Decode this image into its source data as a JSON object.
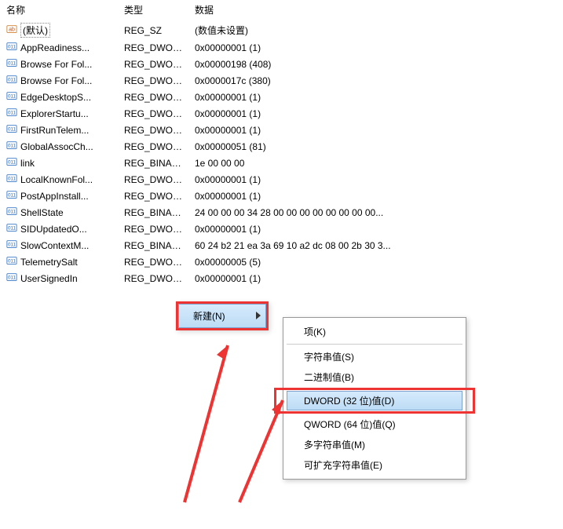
{
  "headers": {
    "name": "名称",
    "type": "类型",
    "data": "数据"
  },
  "rows": [
    {
      "icon": "string",
      "name": "(默认)",
      "type": "REG_SZ",
      "data": "(数值未设置)",
      "focus": true
    },
    {
      "icon": "dword",
      "name": "AppReadiness...",
      "type": "REG_DWORD",
      "data": "0x00000001 (1)"
    },
    {
      "icon": "dword",
      "name": "Browse For Fol...",
      "type": "REG_DWORD",
      "data": "0x00000198 (408)"
    },
    {
      "icon": "dword",
      "name": "Browse For Fol...",
      "type": "REG_DWORD",
      "data": "0x0000017c (380)"
    },
    {
      "icon": "dword",
      "name": "EdgeDesktopS...",
      "type": "REG_DWORD",
      "data": "0x00000001 (1)"
    },
    {
      "icon": "dword",
      "name": "ExplorerStartu...",
      "type": "REG_DWORD",
      "data": "0x00000001 (1)"
    },
    {
      "icon": "dword",
      "name": "FirstRunTelem...",
      "type": "REG_DWORD",
      "data": "0x00000001 (1)"
    },
    {
      "icon": "dword",
      "name": "GlobalAssocCh...",
      "type": "REG_DWORD",
      "data": "0x00000051 (81)"
    },
    {
      "icon": "binary",
      "name": "link",
      "type": "REG_BINARY",
      "data": "1e 00 00 00"
    },
    {
      "icon": "dword",
      "name": "LocalKnownFol...",
      "type": "REG_DWORD",
      "data": "0x00000001 (1)"
    },
    {
      "icon": "dword",
      "name": "PostAppInstall...",
      "type": "REG_DWORD",
      "data": "0x00000001 (1)"
    },
    {
      "icon": "binary",
      "name": "ShellState",
      "type": "REG_BINARY",
      "data": "24 00 00 00 34 28 00 00 00 00 00 00 00 00..."
    },
    {
      "icon": "dword",
      "name": "SIDUpdatedO...",
      "type": "REG_DWORD",
      "data": "0x00000001 (1)"
    },
    {
      "icon": "binary",
      "name": "SlowContextM...",
      "type": "REG_BINARY",
      "data": "60 24 b2 21 ea 3a 69 10 a2 dc 08 00 2b 30 3..."
    },
    {
      "icon": "dword",
      "name": "TelemetrySalt",
      "type": "REG_DWORD",
      "data": "0x00000005 (5)"
    },
    {
      "icon": "dword",
      "name": "UserSignedIn",
      "type": "REG_DWORD",
      "data": "0x00000001 (1)"
    }
  ],
  "context_menu": {
    "new_label": "新建(N)",
    "items": {
      "key": "项(K)",
      "string": "字符串值(S)",
      "binary": "二进制值(B)",
      "dword": "DWORD (32 位)值(D)",
      "qword": "QWORD (64 位)值(Q)",
      "multistring": "多字符串值(M)",
      "expandable": "可扩充字符串值(E)"
    }
  },
  "colors": {
    "highlight_border": "#e33",
    "menu_selected_bg": "#bcdcf5"
  }
}
